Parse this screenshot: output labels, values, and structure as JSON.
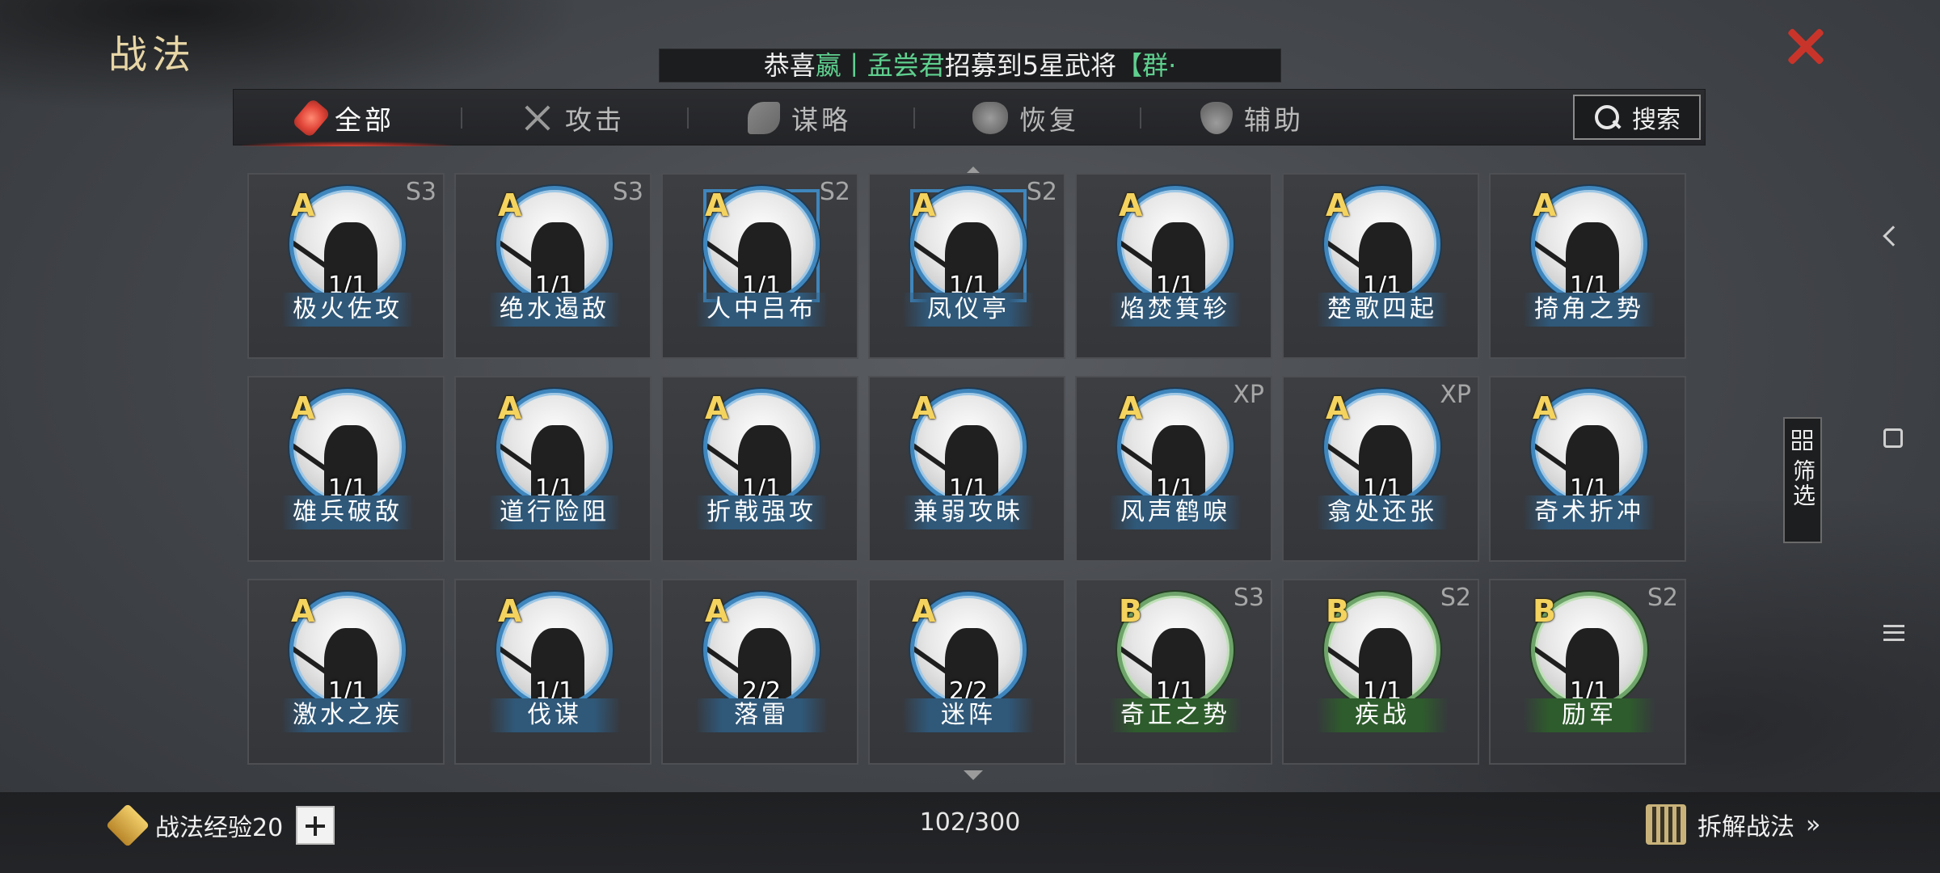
{
  "header": {
    "title": "战法",
    "ticker": {
      "prefix": "恭喜",
      "user": "嬴丨孟尝君",
      "middle": "招募到5星武将",
      "general": "【群·"
    }
  },
  "tabs": [
    {
      "label": "全部",
      "icon": "all-icon",
      "active": true
    },
    {
      "label": "攻击",
      "icon": "crossed-swords-icon",
      "active": false
    },
    {
      "label": "谋略",
      "icon": "scheme-icon",
      "active": false
    },
    {
      "label": "恢复",
      "icon": "recover-icon",
      "active": false
    },
    {
      "label": "辅助",
      "icon": "assist-icon",
      "active": false
    }
  ],
  "search": {
    "label": "搜索"
  },
  "skills": [
    {
      "name": "极火佐攻",
      "grade": "A",
      "count": "1/1",
      "season": "S3",
      "frame": "circle"
    },
    {
      "name": "绝水遏敌",
      "grade": "A",
      "count": "1/1",
      "season": "S3",
      "frame": "circle"
    },
    {
      "name": "人中吕布",
      "grade": "A",
      "count": "1/1",
      "season": "S2",
      "frame": "square"
    },
    {
      "name": "凤仪亭",
      "grade": "A",
      "count": "1/1",
      "season": "S2",
      "frame": "square"
    },
    {
      "name": "焰焚箕轸",
      "grade": "A",
      "count": "1/1",
      "season": "",
      "frame": "circle"
    },
    {
      "name": "楚歌四起",
      "grade": "A",
      "count": "1/1",
      "season": "",
      "frame": "circle"
    },
    {
      "name": "掎角之势",
      "grade": "A",
      "count": "1/1",
      "season": "",
      "frame": "circle"
    },
    {
      "name": "雄兵破敌",
      "grade": "A",
      "count": "1/1",
      "season": "",
      "frame": "circle"
    },
    {
      "name": "道行险阻",
      "grade": "A",
      "count": "1/1",
      "season": "",
      "frame": "circle"
    },
    {
      "name": "折戟强攻",
      "grade": "A",
      "count": "1/1",
      "season": "",
      "frame": "circle"
    },
    {
      "name": "兼弱攻昧",
      "grade": "A",
      "count": "1/1",
      "season": "",
      "frame": "circle"
    },
    {
      "name": "风声鹤唳",
      "grade": "A",
      "count": "1/1",
      "season": "XP",
      "frame": "circle"
    },
    {
      "name": "翕处还张",
      "grade": "A",
      "count": "1/1",
      "season": "XP",
      "frame": "circle"
    },
    {
      "name": "奇术折冲",
      "grade": "A",
      "count": "1/1",
      "season": "",
      "frame": "circle"
    },
    {
      "name": "激水之疾",
      "grade": "A",
      "count": "1/1",
      "season": "",
      "frame": "circle"
    },
    {
      "name": "伐谋",
      "grade": "A",
      "count": "1/1",
      "season": "",
      "frame": "circle"
    },
    {
      "name": "落雷",
      "grade": "A",
      "count": "2/2",
      "season": "",
      "frame": "circle"
    },
    {
      "name": "迷阵",
      "grade": "A",
      "count": "2/2",
      "season": "",
      "frame": "circle"
    },
    {
      "name": "奇正之势",
      "grade": "B",
      "count": "1/1",
      "season": "S3",
      "frame": "circle"
    },
    {
      "name": "疾战",
      "grade": "B",
      "count": "1/1",
      "season": "S2",
      "frame": "circle"
    },
    {
      "name": "励军",
      "grade": "B",
      "count": "1/1",
      "season": "S2",
      "frame": "circle"
    }
  ],
  "side": {
    "filter_label": "筛选"
  },
  "footer": {
    "exp_label": "战法经验20",
    "capacity": "102/300",
    "dismantle_label": "拆解战法",
    "dismantle_chevron": "»"
  },
  "colors": {
    "accent_red": "#c9342a",
    "grade_gold": "#f4d35e",
    "frame_blue": "#3f86bd",
    "frame_green": "#6ea46a",
    "ticker_green": "#5fd08f"
  }
}
